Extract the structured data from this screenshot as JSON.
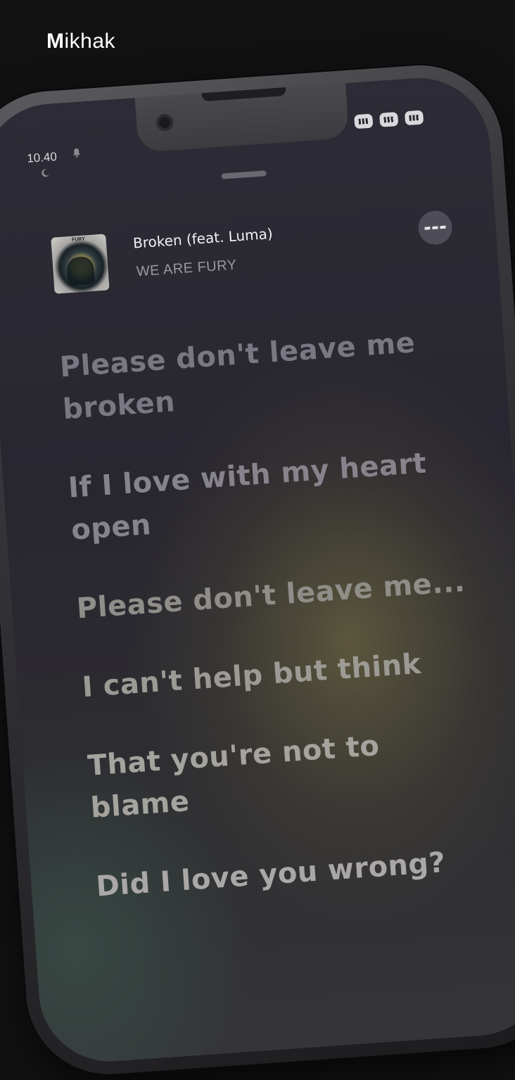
{
  "brand": {
    "first_letter": "M",
    "rest": "ikhak"
  },
  "status_bar": {
    "time": "10.40",
    "icons": [
      "bell-icon",
      "moon-icon",
      "signal-icon",
      "wifi-icon",
      "battery-icon"
    ]
  },
  "now_playing": {
    "title": "Broken (feat. Luma)",
    "artist": "WE ARE FURY",
    "album_art_text": "FURY",
    "more_icon": "more-icon"
  },
  "lyrics": [
    "Please don't leave me broken",
    "If I love with my heart open",
    "Please don't leave me...",
    "I can't help but think",
    "That you're not to blame",
    "Did I love you wrong?"
  ],
  "colors": {
    "background": "#121212",
    "screen": "#2d2b35",
    "highlight": "#827a46"
  }
}
